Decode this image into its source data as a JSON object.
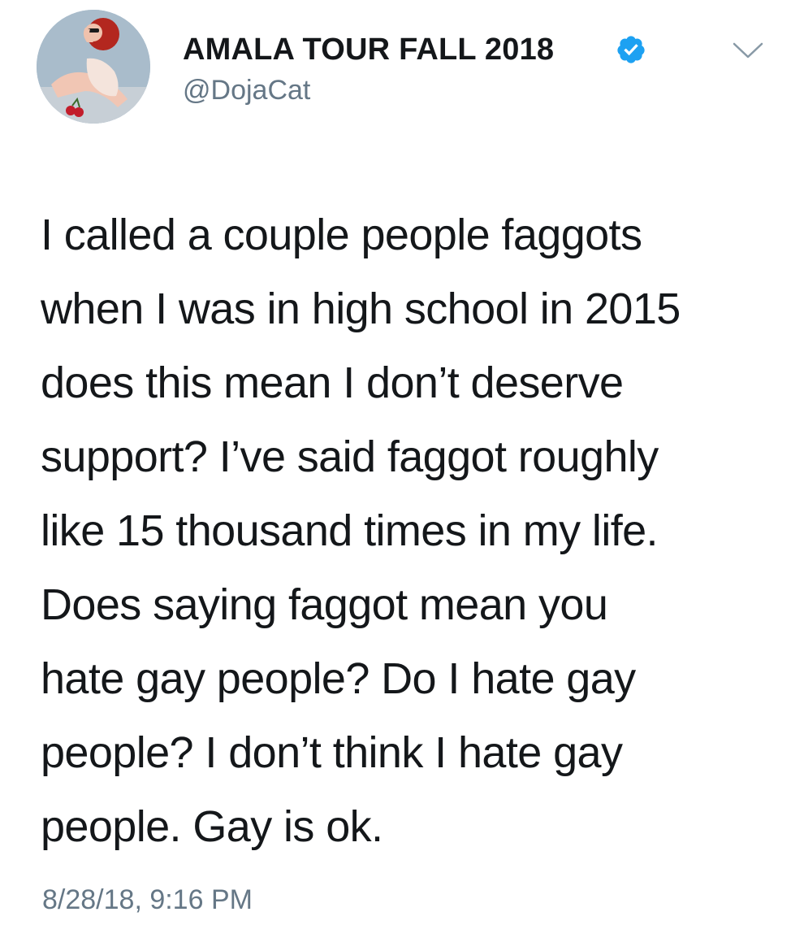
{
  "tweet": {
    "display_name": "AMALA TOUR FALL 2018",
    "handle": "@DojaCat",
    "verified": true,
    "verified_icon": "verified-badge-icon",
    "menu_icon": "chevron-down-icon",
    "text_lines": [
      "I called a couple people faggots",
      "when I was in high school in 2015",
      "does this mean I don’t deserve",
      "support? I’ve said faggot roughly",
      "like 15 thousand times in my life.",
      "Does saying faggot mean you",
      "hate gay people? Do I hate gay",
      "people? I don’t think I hate gay",
      "people. Gay is ok."
    ],
    "timestamp": "8/28/18, 9:16 PM"
  },
  "colors": {
    "text": "#14171a",
    "secondary_text": "#657786",
    "verified_blue": "#1da1f2",
    "background": "#ffffff"
  }
}
